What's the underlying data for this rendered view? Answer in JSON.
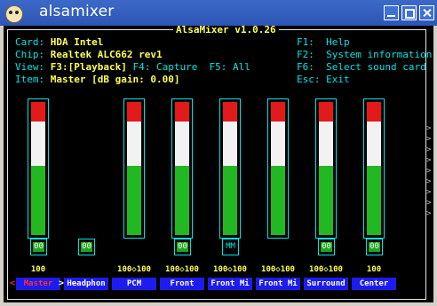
{
  "window": {
    "title": "alsamixer"
  },
  "mixer": {
    "title": "AlsaMixer v1.0.26",
    "info": [
      {
        "key": "Card:",
        "value": "HDA Intel"
      },
      {
        "key": "Chip:",
        "value": "Realtek ALC662 rev1"
      },
      {
        "key": "View:",
        "value": "F3:[Playback]",
        "extra": " F4: Capture  F5: All"
      },
      {
        "key": "Item:",
        "value": "Master [dB gain: 0.00]"
      }
    ],
    "keys": [
      {
        "key": "F1:",
        "label": "Help"
      },
      {
        "key": "F2:",
        "label": "System information"
      },
      {
        "key": "F6:",
        "label": "Select sound card"
      },
      {
        "key": "Esc:",
        "label": "Exit"
      }
    ]
  },
  "channels": [
    {
      "name": "Master",
      "volume_pct": 100,
      "label": "100",
      "mute": "00",
      "has_bar": true,
      "selected": true
    },
    {
      "name": "Headphon",
      "volume_pct": null,
      "label": "",
      "mute": "00",
      "has_bar": false,
      "selected": false
    },
    {
      "name": "PCM",
      "volume_pct": 100,
      "label": "100◇100",
      "mute": "",
      "has_bar": true,
      "selected": false
    },
    {
      "name": "Front",
      "volume_pct": 100,
      "label": "100◇100",
      "mute": "00",
      "has_bar": true,
      "selected": false
    },
    {
      "name": "Front Mi",
      "volume_pct": 100,
      "label": "100◇100",
      "mute": "MM",
      "has_bar": true,
      "selected": false
    },
    {
      "name": "Front Mi",
      "volume_pct": 100,
      "label": "100◇100",
      "mute": "",
      "has_bar": true,
      "selected": false
    },
    {
      "name": "Surround",
      "volume_pct": 100,
      "label": "100◇100",
      "mute": "00",
      "has_bar": true,
      "selected": false
    },
    {
      "name": "Center",
      "volume_pct": 100,
      "label": "100",
      "mute": "00",
      "has_bar": true,
      "selected": false
    }
  ],
  "colors": {
    "title_bar": "#3c69c9",
    "terminal_bg": "#000000",
    "cyan": "#00e4e4",
    "yellow": "#ffff54",
    "label_bg": "#1c1cf0"
  }
}
